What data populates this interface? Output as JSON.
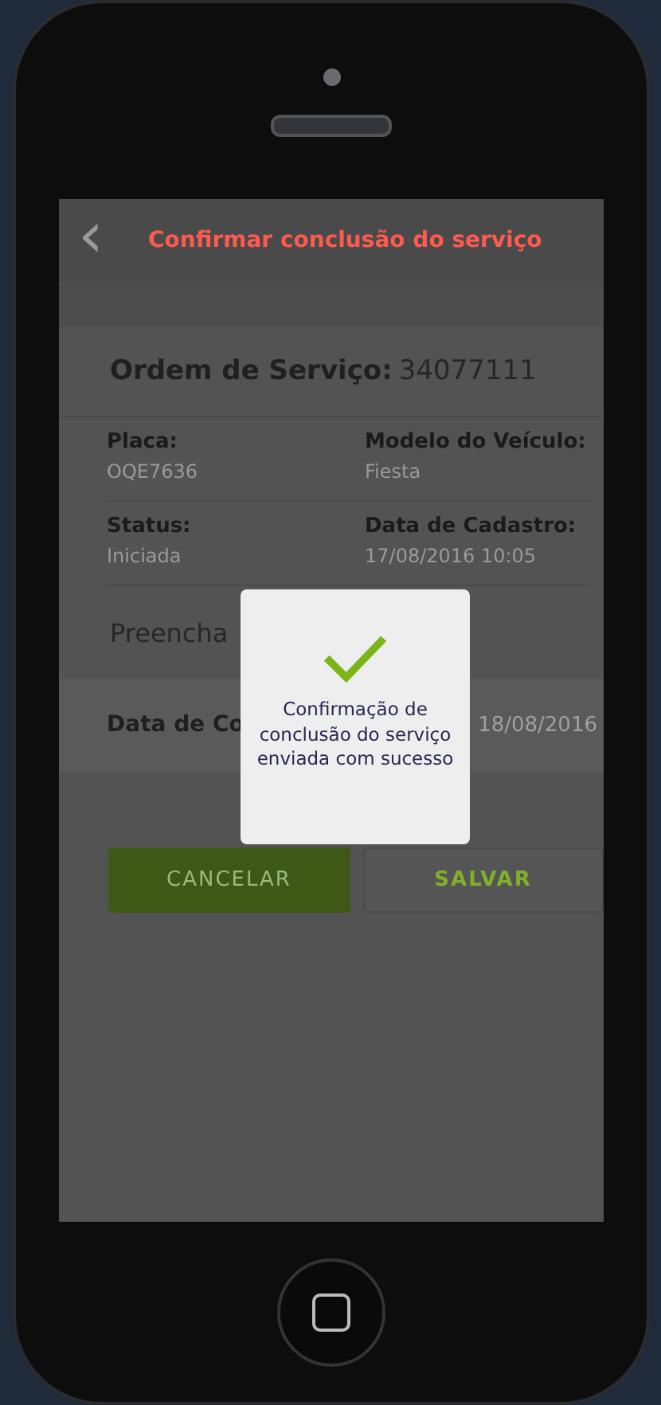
{
  "header": {
    "back": "‹",
    "title": "Confirmar conclusão do serviço"
  },
  "order": {
    "label": "Ordem de Serviço:",
    "number": "34077111"
  },
  "fields": [
    {
      "label": "Placa:",
      "value": "OQE7636"
    },
    {
      "label": "Modelo do Veículo:",
      "value": "Fiesta"
    },
    {
      "label": "Status:",
      "value": "Iniciada"
    },
    {
      "label": "Data de Cadastro:",
      "value": "17/08/2016 10:05"
    }
  ],
  "instruction": "Preencha",
  "conclusion": {
    "label": "Data de Co",
    "value": "18/08/2016"
  },
  "buttons": [
    {
      "label": "CANCELAR",
      "kind": "primary"
    },
    {
      "label": "SALVAR",
      "kind": "secondary"
    }
  ],
  "dialog": {
    "message": "Confirmação de conclusão do serviço enviada com sucesso"
  }
}
